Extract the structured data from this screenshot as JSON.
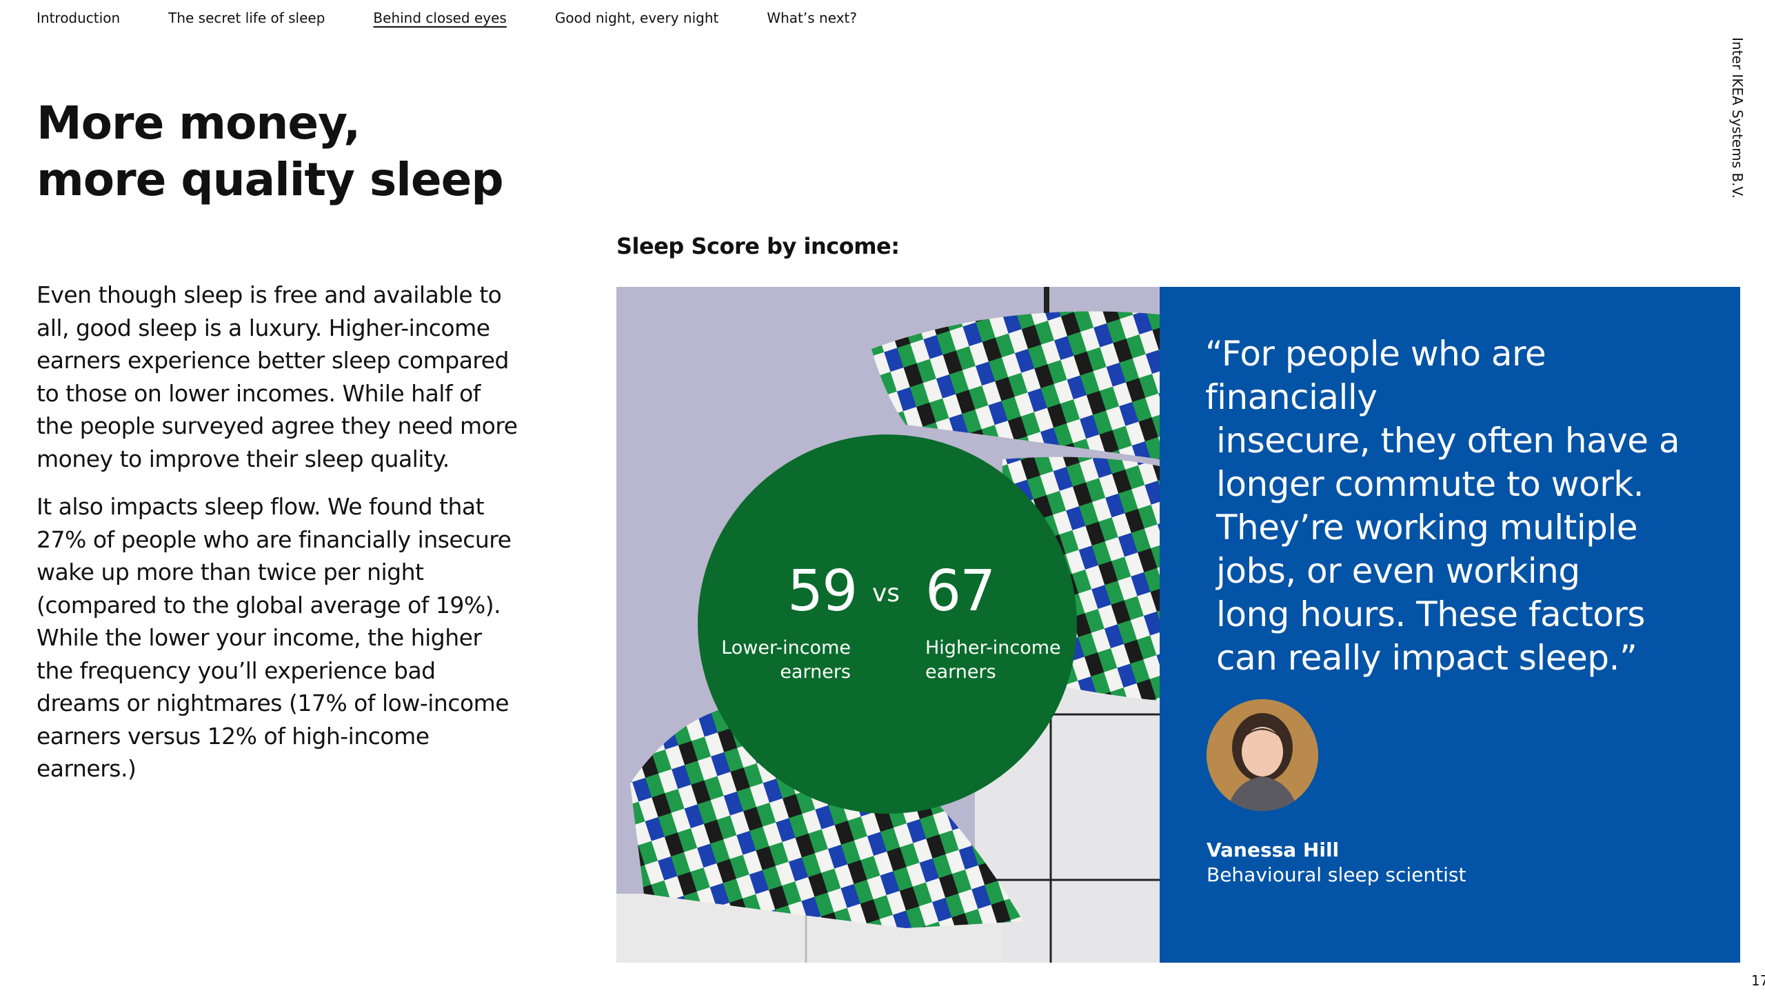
{
  "nav": {
    "items": [
      {
        "label": "Introduction"
      },
      {
        "label": "The secret life of sleep"
      },
      {
        "label": "Behind closed eyes",
        "active": true
      },
      {
        "label": "Good night, every night"
      },
      {
        "label": "What’s next?"
      }
    ]
  },
  "brand": "Inter IKEA Systems B.V.",
  "title": {
    "line1": "More money,",
    "line2": "more quality sleep"
  },
  "body": {
    "p1": "Even though sleep is free and available to all, good sleep is a luxury. Higher-income earners experience better sleep compared to those on lower incomes. While half of the people surveyed agree they need more money to improve their sleep quality.",
    "p2": "It also impacts sleep flow. We found that 27% of people who are financially insecure wake up more than twice per night (compared to the global average of 19%). While the lower your income, the higher the frequency you’ll experience bad dreams or nightmares (17% of low-income earners versus 12% of high-income earners.)"
  },
  "stat": {
    "heading": "Sleep Score by income:",
    "low": {
      "value": "59",
      "label1": "Lower-income",
      "label2": "earners"
    },
    "vs": "vs",
    "high": {
      "value": "67",
      "label1": "Higher-income",
      "label2": "earners"
    }
  },
  "quote": {
    "lines": [
      "“For people who are financially",
      "insecure, they often have a",
      "longer commute to work.",
      "They’re working multiple",
      "jobs, or even working",
      "long hours. These factors",
      "can really impact sleep.”"
    ],
    "name": "Vanessa Hill",
    "role": "Behavioural sleep scientist"
  },
  "page_number": "17",
  "colors": {
    "quote_panel": "#0353a6",
    "stat_circle": "#0a6b2c",
    "photo_background": "#b9b6cf"
  }
}
